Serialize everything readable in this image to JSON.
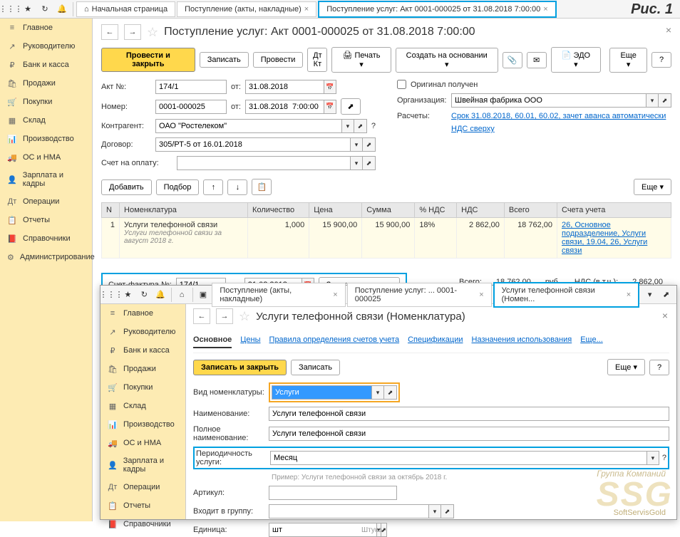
{
  "ris_label": "Рис. 1",
  "top_tabs": {
    "home": "Начальная страница",
    "tab1": "Поступление (акты, накладные)",
    "tab2": "Поступление услуг: Акт 0001-000025 от 31.08.2018 7:00:00"
  },
  "sidebar": [
    {
      "icon": "≡",
      "label": "Главное"
    },
    {
      "icon": "↗",
      "label": "Руководителю"
    },
    {
      "icon": "₽",
      "label": "Банк и касса"
    },
    {
      "icon": "🛍",
      "label": "Продажи"
    },
    {
      "icon": "🛒",
      "label": "Покупки"
    },
    {
      "icon": "▦",
      "label": "Склад"
    },
    {
      "icon": "📊",
      "label": "Производство"
    },
    {
      "icon": "🚚",
      "label": "ОС и НМА"
    },
    {
      "icon": "👤",
      "label": "Зарплата и кадры"
    },
    {
      "icon": "Дт",
      "label": "Операции"
    },
    {
      "icon": "📋",
      "label": "Отчеты"
    },
    {
      "icon": "📕",
      "label": "Справочники"
    },
    {
      "icon": "⚙",
      "label": "Администрирование"
    }
  ],
  "doc_title": "Поступление услуг: Акт 0001-000025 от 31.08.2018 7:00:00",
  "actions": {
    "primary": "Провести и закрыть",
    "save": "Записать",
    "post": "Провести",
    "print": "Печать",
    "create_based": "Создать на основании",
    "edo": "ЭДО",
    "more": "Еще"
  },
  "fields": {
    "akt_label": "Акт №:",
    "akt_value": "174/1",
    "ot_label": "от:",
    "akt_date": "31.08.2018",
    "nomer_label": "Номер:",
    "nomer_value": "0001-000025",
    "nomer_date": "31.08.2018  7:00:00",
    "original_label": "Оригинал получен",
    "org_label": "Организация:",
    "org_value": "Швейная фабрика ООО",
    "kontragent_label": "Контрагент:",
    "kontragent_value": "ОАО \"Ростелеком\"",
    "raschety_label": "Расчеты:",
    "raschety_link": "Срок 31.08.2018, 60.01, 60.02, зачет аванса автоматически",
    "dogovor_label": "Договор:",
    "dogovor_value": "305/РТ-5 от 16.01.2018",
    "nds_link": "НДС сверху",
    "schet_oplata_label": "Счет на оплату:",
    "add": "Добавить",
    "select": "Подбор"
  },
  "table": {
    "headers": [
      "N",
      "Номенклатура",
      "Количество",
      "Цена",
      "Сумма",
      "% НДС",
      "НДС",
      "Всего",
      "Счета учета"
    ],
    "row": {
      "n": "1",
      "name": "Услуги телефонной связи",
      "desc": "Услуги телефонной связи за август 2018 г.",
      "qty": "1,000",
      "price": "15 900,00",
      "sum": "15 900,00",
      "nds_pct": "18%",
      "nds": "2 862,00",
      "total": "18 762,00",
      "accounts": "26, Основное подразделение, Услуги связи, 19.04, 26, Услуги связи"
    }
  },
  "invoice": {
    "label": "Счет-фактура №:",
    "num": "174/1",
    "ot": "от:",
    "date": "31.08.2018",
    "register": "Зарегистрировать"
  },
  "totals": {
    "total_label": "Всего:",
    "total": "18 762,00",
    "rub": "руб.",
    "nds_label": "НДС (в т.ч.):",
    "nds": "2 862,00"
  },
  "win2": {
    "tabs": {
      "tab1": "Поступление (акты, накладные)",
      "tab2": "Поступление услуг: ... 0001-000025",
      "tab3": "Услуги телефонной связи (Номен..."
    },
    "title": "Услуги телефонной связи (Номенклатура)",
    "nav": {
      "main": "Основное",
      "prices": "Цены",
      "rules": "Правила определения счетов учета",
      "spec": "Спецификации",
      "usage": "Назначения использования",
      "more": "Еще..."
    },
    "save_close": "Записать и закрыть",
    "save": "Записать",
    "more": "Еще",
    "fields": {
      "type_label": "Вид номенклатуры:",
      "type_value": "Услуги",
      "name_label": "Наименование:",
      "name_value": "Услуги телефонной связи",
      "full_label": "Полное наименование:",
      "full_value": "Услуги телефонной связи",
      "period_label": "Периодичность услуги:",
      "period_value": "Месяц",
      "period_hint": "Пример: Услуги телефонной связи за октябрь 2018 г.",
      "artikul_label": "Артикул:",
      "group_label": "Входит в группу:",
      "unit_label": "Единица:",
      "unit_value": "шт",
      "unit_desc": "Штука"
    }
  },
  "watermark": {
    "main": "SSG",
    "top": "Группа Компаний",
    "bottom": "SoftServisGold"
  }
}
